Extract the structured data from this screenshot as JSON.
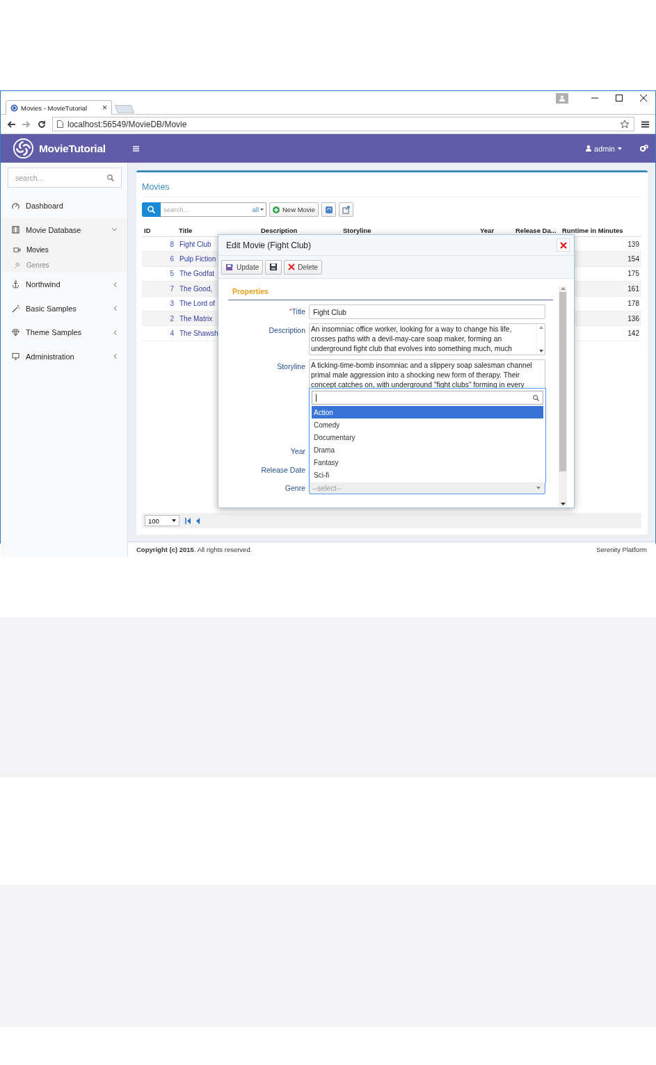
{
  "browser": {
    "tab_title": "Movies - MovieTutorial",
    "tab_close": "×",
    "url": "localhost:56549/MovieDB/Movie"
  },
  "header": {
    "brand": "MovieTutorial",
    "user": "admin"
  },
  "sidebar": {
    "search_placeholder": "search...",
    "items": [
      {
        "label": "Dashboard",
        "kind": "link"
      },
      {
        "label": "Movie Database",
        "kind": "group",
        "expanded": true,
        "children": [
          {
            "label": "Movies",
            "selected": true
          },
          {
            "label": "Genres",
            "selected": false
          }
        ]
      },
      {
        "label": "Northwind",
        "kind": "group",
        "expanded": false
      },
      {
        "label": "Basic Samples",
        "kind": "group",
        "expanded": false
      },
      {
        "label": "Theme Samples",
        "kind": "group",
        "expanded": false
      },
      {
        "label": "Administration",
        "kind": "group",
        "expanded": false
      }
    ]
  },
  "page_title": "Movies",
  "toolbar": {
    "search_placeholder": "search...",
    "field_filter": "all",
    "buttons": [
      {
        "kind": "add",
        "label": "New Movie"
      },
      {
        "kind": "refresh"
      },
      {
        "kind": "columns"
      }
    ]
  },
  "grid": {
    "columns": [
      "ID",
      "Title",
      "Description",
      "Storyline",
      "Year",
      "Release Da...",
      "Runtime in Minutes"
    ],
    "rows": [
      {
        "id": "8",
        "title": "Fight Club",
        "runtime": "139"
      },
      {
        "id": "6",
        "title": "Pulp Fiction",
        "runtime": "154"
      },
      {
        "id": "5",
        "title": "The Godfat",
        "runtime": "175"
      },
      {
        "id": "7",
        "title": "The Good,",
        "runtime": "161"
      },
      {
        "id": "3",
        "title": "The Lord of",
        "runtime": "178"
      },
      {
        "id": "2",
        "title": "The Matrix",
        "runtime": "136"
      },
      {
        "id": "4",
        "title": "The Shawsh",
        "runtime": "142"
      }
    ]
  },
  "pager": {
    "page_size": "100"
  },
  "dialog": {
    "title": "Edit Movie (Fight Club)",
    "required_mark": "*",
    "buttons": [
      {
        "kind": "update",
        "label": "Update"
      },
      {
        "kind": "save"
      },
      {
        "kind": "delete",
        "label": "Delete"
      }
    ],
    "section": "Properties",
    "fields": [
      {
        "label": "Title",
        "required": true,
        "kind": "text",
        "value": "Fight Club"
      },
      {
        "label": "Description",
        "required": false,
        "kind": "textarea",
        "value": "An insomniac office worker, looking for a way to change his life, crosses paths with a devil-may-care soap maker, forming an underground fight club that evolves into something much, much"
      },
      {
        "label": "Storyline",
        "required": false,
        "kind": "textarea",
        "value": "A ticking-time-bomb insomniac and a slippery soap salesman channel primal male aggression into a shocking new form of therapy. Their concept catches on, with underground \"fight clubs\" forming in every"
      },
      {
        "label": "Year",
        "required": false,
        "kind": "covered"
      },
      {
        "label": "Release Date",
        "required": false,
        "kind": "covered"
      },
      {
        "label": "Genre",
        "required": false,
        "kind": "select",
        "placeholder": "--select--"
      }
    ],
    "genre_dropdown": {
      "options": [
        {
          "label": "Action",
          "selected": true
        },
        {
          "label": "Comedy",
          "selected": false
        },
        {
          "label": "Documentary",
          "selected": false
        },
        {
          "label": "Drama",
          "selected": false
        },
        {
          "label": "Fantasy",
          "selected": false
        },
        {
          "label": "Sci-fi",
          "selected": false
        }
      ]
    }
  },
  "footer": {
    "copyright": "**Copyright (c) 2015**. All rights reserved.",
    "platform": "Serenity Platform"
  }
}
